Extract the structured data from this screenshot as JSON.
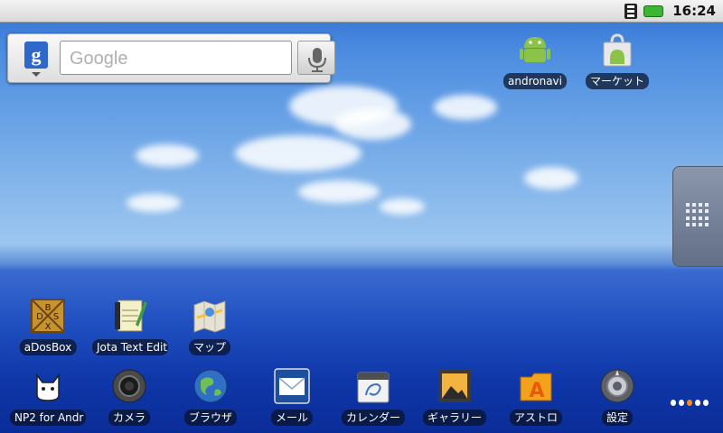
{
  "status_bar": {
    "time": "16:24"
  },
  "search_widget": {
    "placeholder": "Google",
    "g_letter": "g"
  },
  "top_apps": [
    {
      "label": "andronavi",
      "icon": "android-robot-icon"
    },
    {
      "label": "マーケット",
      "icon": "market-bag-icon"
    }
  ],
  "desktop_apps": [
    {
      "label": "aDosBox",
      "icon": "dosbox-icon"
    },
    {
      "label": "Jota Text Edit",
      "icon": "jota-notepad-icon"
    },
    {
      "label": "マップ",
      "icon": "maps-icon"
    }
  ],
  "dock_apps": [
    {
      "label": "NP2 for Andr",
      "icon": "np2-cat-icon"
    },
    {
      "label": "カメラ",
      "icon": "camera-icon"
    },
    {
      "label": "ブラウザ",
      "icon": "browser-globe-icon"
    },
    {
      "label": "メール",
      "icon": "mail-icon"
    },
    {
      "label": "カレンダー",
      "icon": "calendar-icon"
    },
    {
      "label": "ギャラリー",
      "icon": "gallery-icon"
    },
    {
      "label": "アストロ",
      "icon": "astro-folder-icon"
    },
    {
      "label": "設定",
      "icon": "settings-icon"
    }
  ],
  "colors": {
    "battery": "#3cb531",
    "google_blue": "#2e68c8",
    "active_page_dot": "#ff8c1a"
  }
}
